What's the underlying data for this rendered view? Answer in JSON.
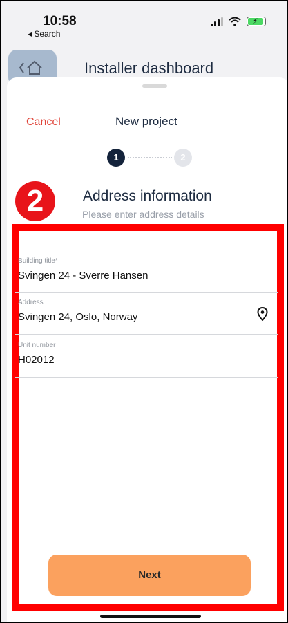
{
  "status_bar": {
    "time": "10:58",
    "back_label": "◂ Search"
  },
  "background": {
    "title": "Installer dashboard"
  },
  "sheet": {
    "cancel_label": "Cancel",
    "title": "New project",
    "steps": [
      "1",
      "2"
    ],
    "current_step": 1,
    "annotation": "2",
    "section_title": "Address information",
    "section_subtitle": "Please enter address details"
  },
  "form": {
    "building_title": {
      "label": "Building title*",
      "value": "Svingen 24 - Sverre Hansen"
    },
    "address": {
      "label": "Address",
      "value": "Svingen 24, Oslo, Norway"
    },
    "unit_number": {
      "label": "Unit number",
      "value": "H02012"
    }
  },
  "actions": {
    "next_label": "Next"
  },
  "colors": {
    "accent": "#fba15e",
    "cancel": "#e0453a",
    "primary_dark": "#14233b",
    "highlight": "#ff0000"
  }
}
